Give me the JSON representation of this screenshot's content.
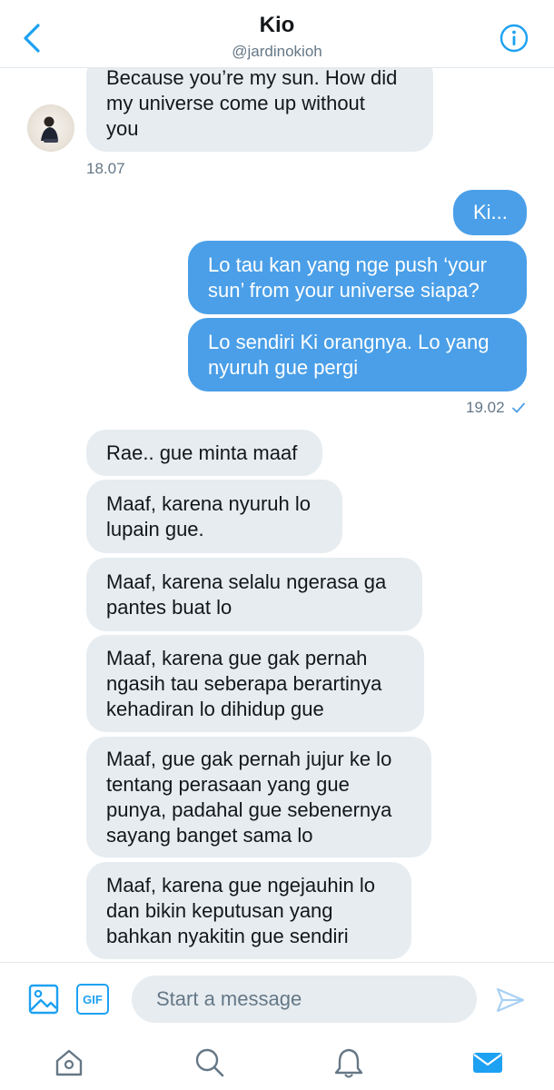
{
  "header": {
    "title": "Kio",
    "handle": "@jardinokioh",
    "back_icon": "chevron-left-icon",
    "info_icon": "info-circle-icon",
    "accent": "#1da1f2"
  },
  "messages": {
    "received_1": {
      "lines": [
        "Because you’re my sun. How did",
        "my universe come up without",
        "you"
      ],
      "time": "18.07"
    },
    "sent_1": {
      "lines": [
        "Ki..."
      ]
    },
    "sent_2": {
      "lines": [
        "Lo tau kan yang nge push ‘your",
        "sun’ from your universe siapa?"
      ]
    },
    "sent_3": {
      "lines": [
        "Lo sendiri Ki orangnya. Lo yang",
        "nyuruh gue pergi"
      ],
      "time": "19.02",
      "status_icon": "check-icon"
    },
    "received_2": {
      "lines": [
        "Rae.. gue minta maaf"
      ]
    },
    "received_3": {
      "lines": [
        "Maaf, karena nyuruh lo",
        "lupain gue."
      ]
    },
    "received_4": {
      "lines": [
        "Maaf, karena selalu ngerasa ga",
        "pantes buat lo"
      ]
    },
    "received_5": {
      "lines": [
        "Maaf, karena gue gak pernah",
        "ngasih tau seberapa berartinya",
        "kehadiran lo dihidup gue"
      ]
    },
    "received_6": {
      "lines": [
        "Maaf, gue gak pernah jujur ke lo",
        "tentang perasaan yang gue",
        "punya, padahal gue sebenernya",
        "sayang banget sama lo"
      ]
    },
    "received_7": {
      "lines": [
        "Maaf, karena gue ngejauhin lo",
        "dan bikin keputusan yang",
        "bahkan nyakitin gue sendiri"
      ]
    }
  },
  "composer": {
    "placeholder": "Start a message",
    "image_icon": "image-icon",
    "gif_label": "GIF",
    "send_icon": "send-icon"
  },
  "tabbar": {
    "items": [
      "home-icon",
      "search-icon",
      "notifications-bell-icon",
      "messages-mail-icon"
    ],
    "active": "messages-mail-icon"
  },
  "colors": {
    "sent_bubble": "#4a9fe8",
    "received_bubble": "#e6ecf0",
    "secondary_text": "#657786"
  }
}
